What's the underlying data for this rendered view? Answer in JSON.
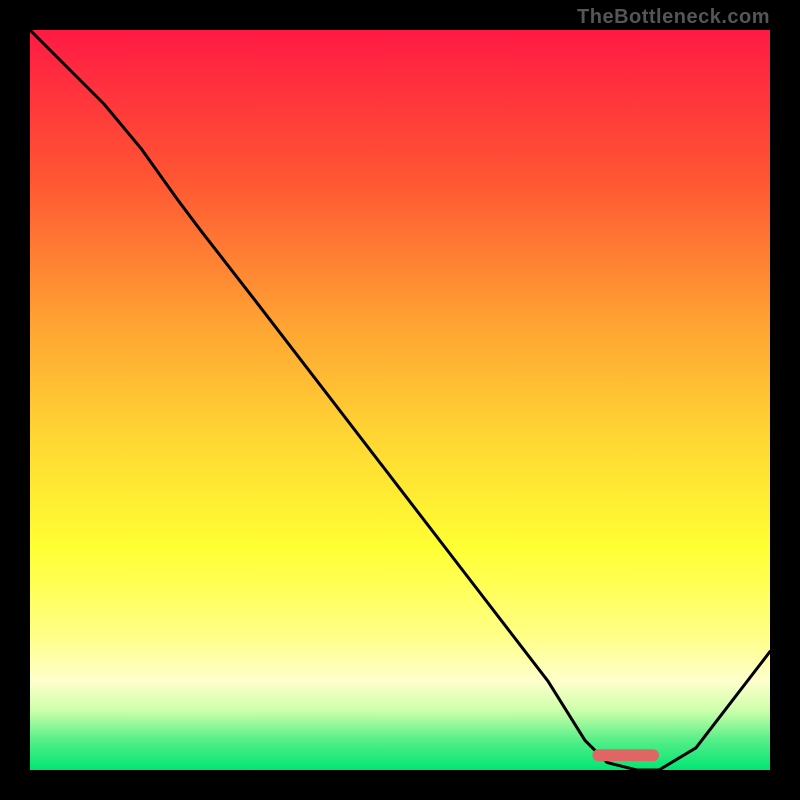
{
  "watermark": "TheBottleneck.com",
  "chart_data": {
    "type": "line",
    "title": "",
    "xlabel": "",
    "ylabel": "",
    "xlim": [
      0,
      100
    ],
    "ylim": [
      0,
      100
    ],
    "x": [
      0,
      5,
      10,
      15,
      20,
      23,
      30,
      40,
      50,
      60,
      70,
      75,
      78,
      82,
      85,
      90,
      100
    ],
    "values": [
      100,
      95,
      90,
      84,
      77,
      73,
      64,
      51,
      38,
      25,
      12,
      4,
      1,
      0,
      0,
      3,
      16
    ],
    "marker": {
      "x_start": 76,
      "x_end": 85,
      "y": 2,
      "color": "#e06666"
    },
    "gradient_stops": [
      {
        "offset": 0.0,
        "color": "#ff1a44"
      },
      {
        "offset": 0.2,
        "color": "#ff5533"
      },
      {
        "offset": 0.4,
        "color": "#ffa433"
      },
      {
        "offset": 0.55,
        "color": "#ffd633"
      },
      {
        "offset": 0.7,
        "color": "#ffff33"
      },
      {
        "offset": 0.82,
        "color": "#ffff88"
      },
      {
        "offset": 0.88,
        "color": "#ffffcc"
      },
      {
        "offset": 0.92,
        "color": "#ccffaa"
      },
      {
        "offset": 0.96,
        "color": "#55ee88"
      },
      {
        "offset": 1.0,
        "color": "#00e673"
      }
    ]
  }
}
